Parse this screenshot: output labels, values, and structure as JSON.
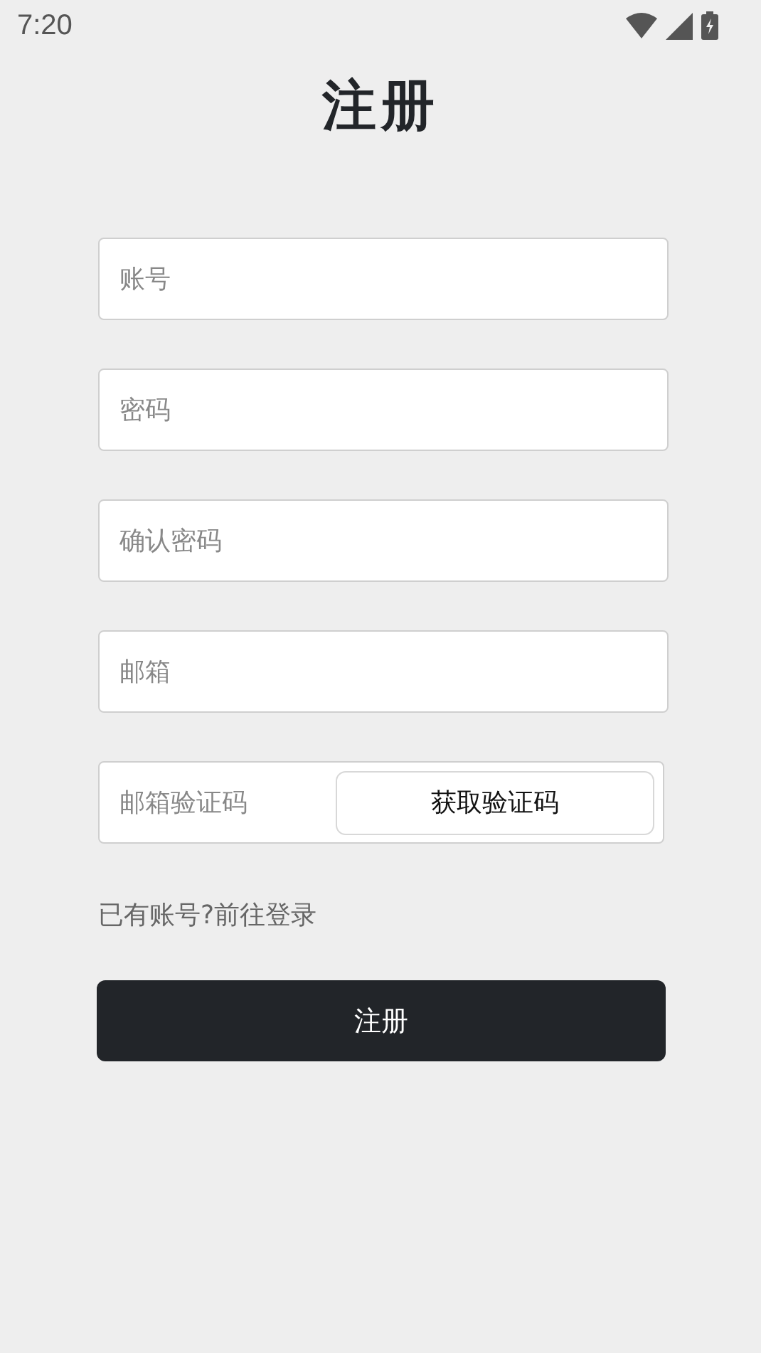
{
  "status_bar": {
    "time": "7:20"
  },
  "title": "注册",
  "fields": [
    {
      "placeholder": "账号"
    },
    {
      "placeholder": "密码"
    },
    {
      "placeholder": "确认密码"
    },
    {
      "placeholder": "邮箱"
    }
  ],
  "code_field": {
    "placeholder": "邮箱验证码",
    "button": "获取验证码"
  },
  "login_link": "已有账号?前往登录",
  "submit": "注册"
}
